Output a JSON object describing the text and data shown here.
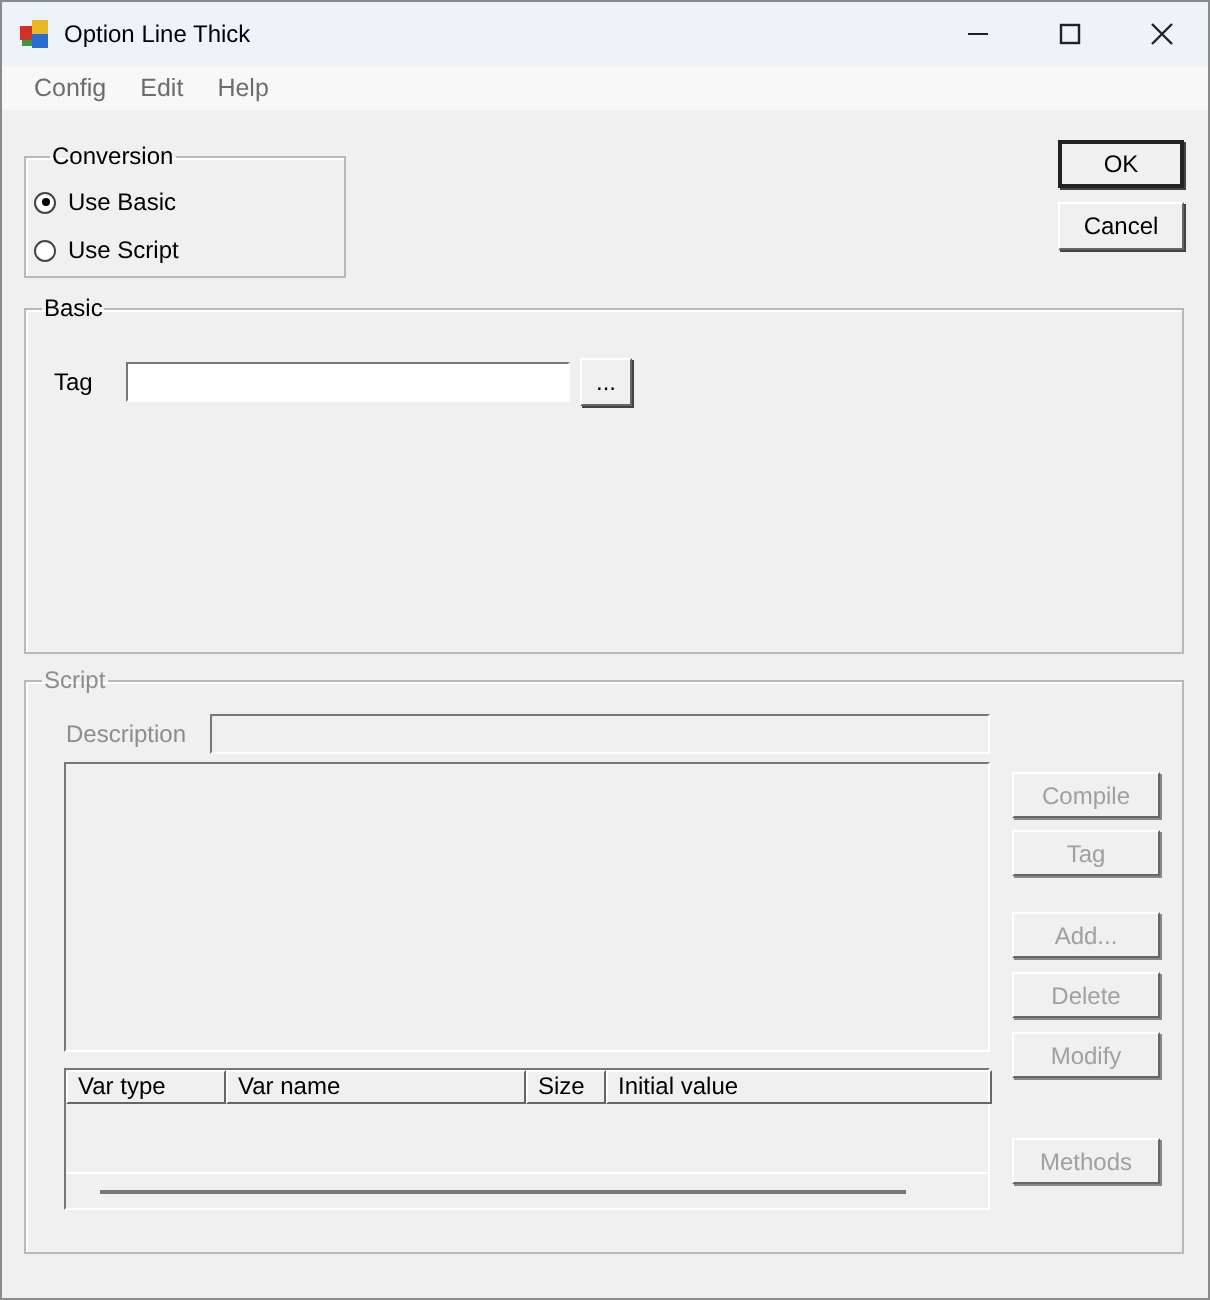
{
  "window": {
    "title": "Option Line Thick"
  },
  "menu": [
    {
      "label": "Config",
      "disabled": true
    },
    {
      "label": "Edit",
      "disabled": true
    },
    {
      "label": "Help",
      "disabled": true
    }
  ],
  "conversion": {
    "title": "Conversion",
    "options": [
      {
        "label": "Use Basic",
        "selected": true
      },
      {
        "label": "Use Script",
        "selected": false
      }
    ]
  },
  "dialog_buttons": [
    {
      "label": "OK",
      "default": true
    },
    {
      "label": "Cancel",
      "default": false
    }
  ],
  "basic": {
    "title": "Basic",
    "disabled": false,
    "tag_label": "Tag",
    "browse_button": "..."
  },
  "script": {
    "title": "Script",
    "disabled": true,
    "description_label": "Description",
    "columns": [
      "Var type",
      "Var name",
      "Size",
      "Initial value"
    ],
    "buttons": [
      "Compile",
      "Tag",
      "Add...",
      "Delete",
      "Modify",
      "Methods"
    ]
  }
}
